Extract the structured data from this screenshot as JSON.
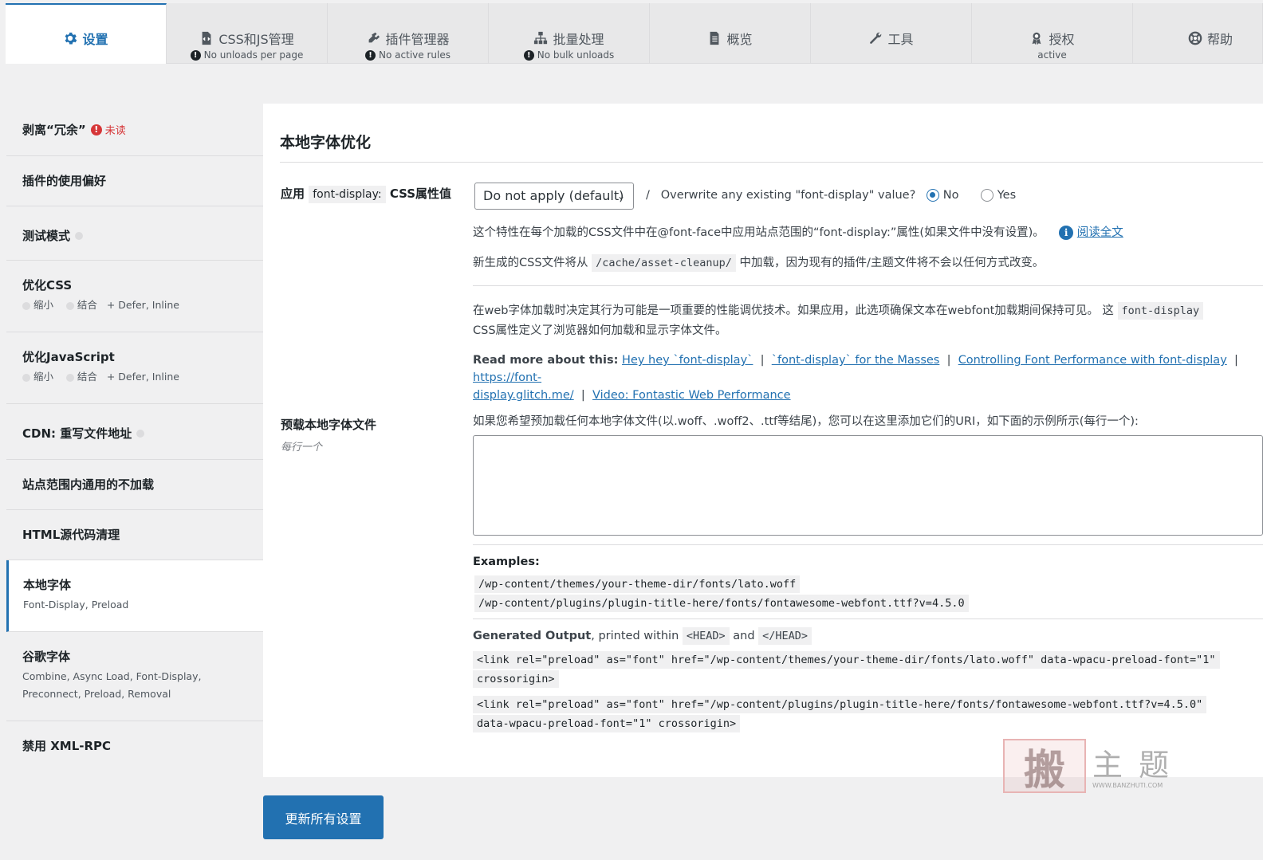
{
  "tabs": [
    {
      "label": "设置",
      "sub": ""
    },
    {
      "label": "CSS和JS管理",
      "sub": "No unloads per page"
    },
    {
      "label": "插件管理器",
      "sub": "No active rules"
    },
    {
      "label": "批量处理",
      "sub": "No bulk unloads"
    },
    {
      "label": "概览",
      "sub": ""
    },
    {
      "label": "工具",
      "sub": ""
    },
    {
      "label": "授权",
      "sub": "active"
    },
    {
      "label": "帮助",
      "sub": ""
    }
  ],
  "sidebar": {
    "strip": {
      "label": "剥离“冗余”",
      "unread": "未读"
    },
    "prefs": {
      "label": "插件的使用偏好"
    },
    "test": {
      "label": "测试模式"
    },
    "css": {
      "label": "优化CSS",
      "minify": "缩小",
      "combine": "结合",
      "extra": "+ Defer, Inline"
    },
    "js": {
      "label": "优化JavaScript",
      "minify": "缩小",
      "combine": "结合",
      "extra": "+ Defer, Inline"
    },
    "cdn": {
      "label": "CDN: 重写文件地址"
    },
    "site": {
      "label": "站点范围内通用的不加载"
    },
    "html": {
      "label": "HTML源代码清理"
    },
    "localfont": {
      "label": "本地字体",
      "meta": "Font-Display, Preload"
    },
    "google": {
      "label": "谷歌字体",
      "meta1": "Combine, Async Load, Font-Display,",
      "meta2": "Preconnect, Preload, Removal"
    },
    "xmlrpc": {
      "label": "禁用 XML-RPC"
    }
  },
  "panel": {
    "title": "本地字体优化",
    "fd_label_pre": "应用",
    "fd_label_code": "font-display:",
    "fd_label_post": "CSS属性值",
    "select_value": "Do not apply (default)",
    "overwrite_q": "Overwrite any existing \"font-display\" value?",
    "no": "No",
    "yes": "Yes",
    "desc1": "这个特性在每个加载的CSS文件中在@font-face中应用站点范围的“font-display:”属性(如果文件中没有设置)。",
    "read_more": "阅读全文",
    "desc2_pre": "新生成的CSS文件将从",
    "desc2_code": "/cache/asset-cleanup/",
    "desc2_post": "中加载，因为现有的插件/主题文件将不会以任何方式改变。",
    "desc3_pre": "在web字体加载时决定其行为可能是一项重要的性能调优技术。如果应用，此选项确保文本在webfont加载期间保持可见。 这",
    "desc3_code": "font-display",
    "desc3_post": "CSS属性定义了浏览器如何加载和显示字体文件。",
    "read_about": "Read more about this:",
    "links": [
      "Hey hey `font-display`",
      "`font-display` for the Masses",
      "Controlling Font Performance with font-display",
      "https://font-",
      "display.glitch.me/",
      "Video: Fontastic Web Performance"
    ],
    "preload_label": "预载本地字体文件",
    "preload_sub": "每行一个",
    "preload_desc": "如果您希望预加载任何本地字体文件(以.woff、.woff2、.ttf等结尾)，您可以在这里添加它们的URI，如下面的示例所示(每行一个):",
    "examples_label": "Examples:",
    "ex1": "/wp-content/themes/your-theme-dir/fonts/lato.woff",
    "ex2": "/wp-content/plugins/plugin-title-here/fonts/fontawesome-webfont.ttf?v=4.5.0",
    "gen_bold": "Generated Output",
    "gen_mid": ", printed within",
    "gen_head": "<HEAD>",
    "gen_and": "and",
    "gen_endhead": "</HEAD>",
    "out1a": "<link rel=\"preload\" as=\"font\" href=\"/wp-content/themes/your-theme-dir/fonts/lato.woff\" data-wpacu-preload-font=\"1\"",
    "out1b": "crossorigin>",
    "out2a": "<link rel=\"preload\" as=\"font\" href=\"/wp-content/plugins/plugin-title-here/fonts/fontawesome-webfont.ttf?v=4.5.0\"",
    "out2b": "data-wpacu-preload-font=\"1\" crossorigin>"
  },
  "save_button": "更新所有设置",
  "watermark": {
    "text": "主 题",
    "url": "WWW.BANZHUTI.COM",
    "logo": "搬"
  }
}
